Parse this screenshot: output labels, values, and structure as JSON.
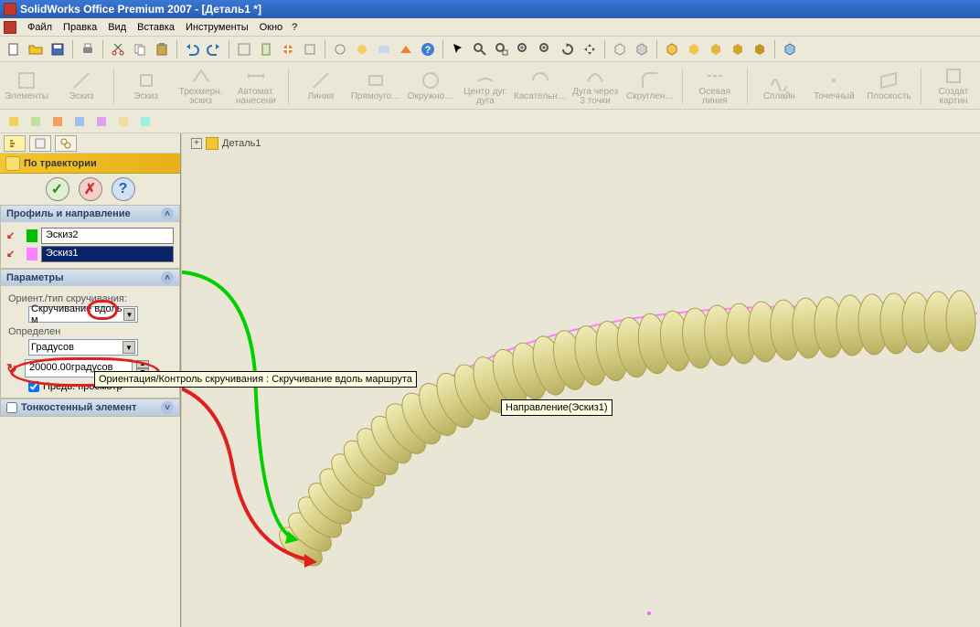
{
  "title": "SolidWorks Office Premium 2007 - [Деталь1 *]",
  "menu": {
    "file": "Файл",
    "edit": "Правка",
    "view": "Вид",
    "insert": "Вставка",
    "tools": "Инструменты",
    "window": "Окно",
    "help": "?"
  },
  "ribbon": {
    "elements": "Элементы",
    "sketch": "Эскиз",
    "sketch2": "Эскиз",
    "three_sketch": "Трехмерн. эскиз",
    "auto_dim": "Автомат. нанесени",
    "line": "Линия",
    "rect": "Прямоуго…",
    "circle": "Окружно…",
    "center_arc": "Центр дуг. дуга",
    "tangent_arc": "Касательн…",
    "three_pt_arc": "Дуга через 3 точки",
    "fillet": "Скруглен…",
    "centerline": "Осевая линия",
    "spline": "Сплайн",
    "point": "Точечный",
    "plane": "Плоскость",
    "create": "Создат картин"
  },
  "feature": {
    "title": "По траектории"
  },
  "group_profile": {
    "title": "Профиль и направление",
    "profile": "Эскиз2",
    "path": "Эскиз1"
  },
  "group_params": {
    "title": "Параметры",
    "orient_label": "Ориент./тип скручивания:",
    "orient_value": "Скручивание вдоль м",
    "define_label": "Определен",
    "define_value": "Градусов",
    "angle_value": "20000.00градусов",
    "preview": "Предв. просмотр"
  },
  "group_thin": {
    "title": "Тонкостенный элемент"
  },
  "doc": {
    "name": "Деталь1"
  },
  "tooltip_orient": "Ориентация/Контроль скручивания : Скручивание вдоль маршрута",
  "tooltip_path": "Направление(Эскиз1)",
  "chart_data": null
}
